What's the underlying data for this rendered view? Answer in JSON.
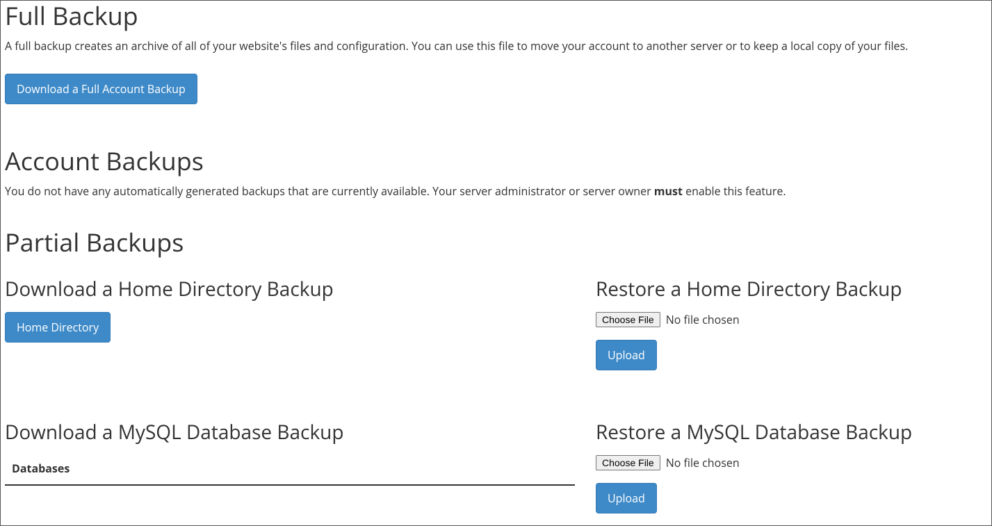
{
  "full_backup": {
    "heading": "Full Backup",
    "description": "A full backup creates an archive of all of your website's files and configuration. You can use this file to move your account to another server or to keep a local copy of your files.",
    "button": "Download a Full Account Backup"
  },
  "account_backups": {
    "heading": "Account Backups",
    "desc_pre": "You do not have any automatically generated backups that are currently available. Your server administrator or server owner ",
    "desc_strong": "must",
    "desc_post": " enable this feature."
  },
  "partial_backups": {
    "heading": "Partial Backups",
    "download_home": {
      "heading": "Download a Home Directory Backup",
      "button": "Home Directory"
    },
    "restore_home": {
      "heading": "Restore a Home Directory Backup",
      "choose_file": "Choose File",
      "no_file": "No file chosen",
      "upload": "Upload"
    },
    "download_mysql": {
      "heading": "Download a MySQL Database Backup",
      "table_header": "Databases"
    },
    "restore_mysql": {
      "heading": "Restore a MySQL Database Backup",
      "choose_file": "Choose File",
      "no_file": "No file chosen",
      "upload": "Upload"
    }
  }
}
